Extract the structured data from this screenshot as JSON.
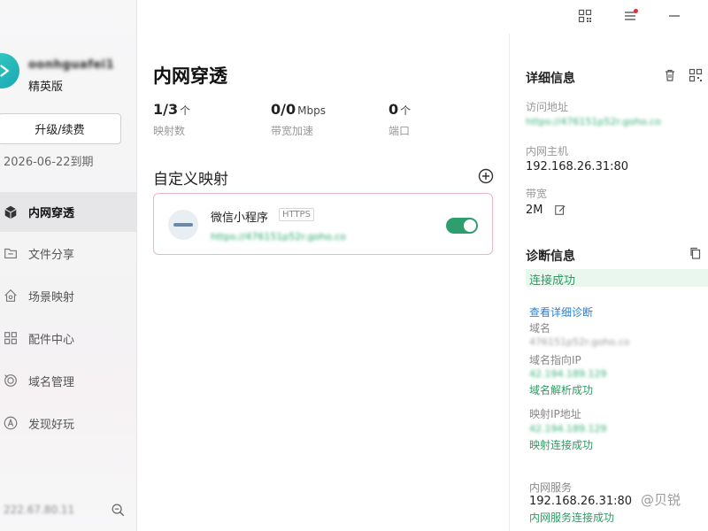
{
  "sidebar": {
    "username": "oonhguafei1",
    "plan": "精英版",
    "upgrade_label": "升级/续费",
    "expire": "2026-06-22到期",
    "nav": [
      {
        "label": "内网穿透",
        "icon": "cube-icon"
      },
      {
        "label": "文件分享",
        "icon": "folder-icon"
      },
      {
        "label": "场景映射",
        "icon": "house-icon"
      },
      {
        "label": "配件中心",
        "icon": "grid-icon"
      },
      {
        "label": "域名管理",
        "icon": "target-icon"
      },
      {
        "label": "发现好玩",
        "icon": "compass-icon"
      }
    ],
    "footer_ip": "222.67.80.11"
  },
  "topbar": {
    "icons": [
      "qr-code-icon",
      "menu-icon",
      "minimize-icon"
    ]
  },
  "main": {
    "title": "内网穿透",
    "stats": [
      {
        "value": "1/3",
        "unit": "个",
        "label": "映射数"
      },
      {
        "value": "0/0",
        "unit": "Mbps",
        "label": "带宽加速"
      },
      {
        "value": "0",
        "unit": "个",
        "label": "端口"
      }
    ],
    "section_title": "自定义映射",
    "mapping": {
      "name": "微信小程序",
      "tag": "HTTPS",
      "url": "https://476151p52r.goho.co",
      "enabled": true
    }
  },
  "detail": {
    "title": "详细信息",
    "access_label": "访问地址",
    "access_url": "https://476151p52r.goho.co",
    "host_label": "内网主机",
    "host_value": "192.168.26.31:80",
    "bandwidth_label": "带宽",
    "bandwidth_value": "2M"
  },
  "diagnostic": {
    "title": "诊断信息",
    "status": "连接成功",
    "view_link": "查看详细诊断",
    "domain_label": "域名",
    "domain_value": "476151p52r.goho.co",
    "domain_ip_label": "域名指向IP",
    "domain_ip_value": "42.194.189.129",
    "domain_ip_status": "域名解析成功",
    "mapping_ip_label": "映射IP地址",
    "mapping_ip_value": "42.194.189.129",
    "mapping_ip_status": "映射连接成功",
    "service_label": "内网服务",
    "service_value": "192.168.26.31:80",
    "service_status": "内网服务连接成功"
  },
  "watermark": "@贝锐"
}
